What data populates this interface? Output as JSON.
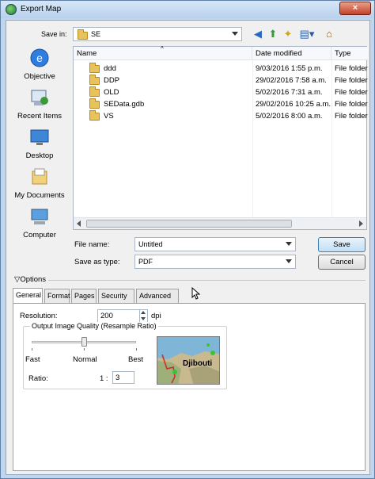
{
  "window": {
    "title": "Export Map",
    "close_symbol": "×"
  },
  "save_in": {
    "label": "Save in:",
    "value": "SE"
  },
  "places": [
    {
      "label": "Objective",
      "icon": "recent-places-icon"
    },
    {
      "label": "Recent Items",
      "icon": "recent-items-icon"
    },
    {
      "label": "Desktop",
      "icon": "desktop-icon"
    },
    {
      "label": "My Documents",
      "icon": "documents-icon"
    },
    {
      "label": "Computer",
      "icon": "computer-icon"
    }
  ],
  "filelist": {
    "columns": [
      "Name",
      "Date modified",
      "Type"
    ],
    "rows": [
      {
        "name": "ddd",
        "date": "9/03/2016 1:55 p.m.",
        "type": "File folder"
      },
      {
        "name": "DDP",
        "date": "29/02/2016 7:58 a.m.",
        "type": "File folder"
      },
      {
        "name": "OLD",
        "date": "5/02/2016 7:31 a.m.",
        "type": "File folder"
      },
      {
        "name": "SEData.gdb",
        "date": "29/02/2016 10:25 a.m.",
        "type": "File folder"
      },
      {
        "name": "VS",
        "date": "5/02/2016 8:00 a.m.",
        "type": "File folder"
      }
    ]
  },
  "file_name": {
    "label": "File name:",
    "value": "Untitled"
  },
  "save_as_type": {
    "label": "Save as type:",
    "value": "PDF"
  },
  "buttons": {
    "save": "Save",
    "cancel": "Cancel"
  },
  "options": {
    "label": "Options",
    "tabs": [
      "General",
      "Format",
      "Pages",
      "Security",
      "Advanced"
    ],
    "active_tab": "General"
  },
  "general": {
    "resolution_label": "Resolution:",
    "resolution_value": "200",
    "resolution_unit": "dpi",
    "quality_group": "Output Image Quality (Resample Ratio)",
    "slider_labels": {
      "fast": "Fast",
      "normal": "Normal",
      "best": "Best"
    },
    "slider_fraction": 0.5,
    "ratio_label": "Ratio:",
    "ratio_prefix": "1 :",
    "ratio_value": "3",
    "preview_label": "Djibouti"
  },
  "colors": {
    "title_gradient_top": "#d6e6f7",
    "accent": "#3c7fb1",
    "close": "#c4402a"
  }
}
